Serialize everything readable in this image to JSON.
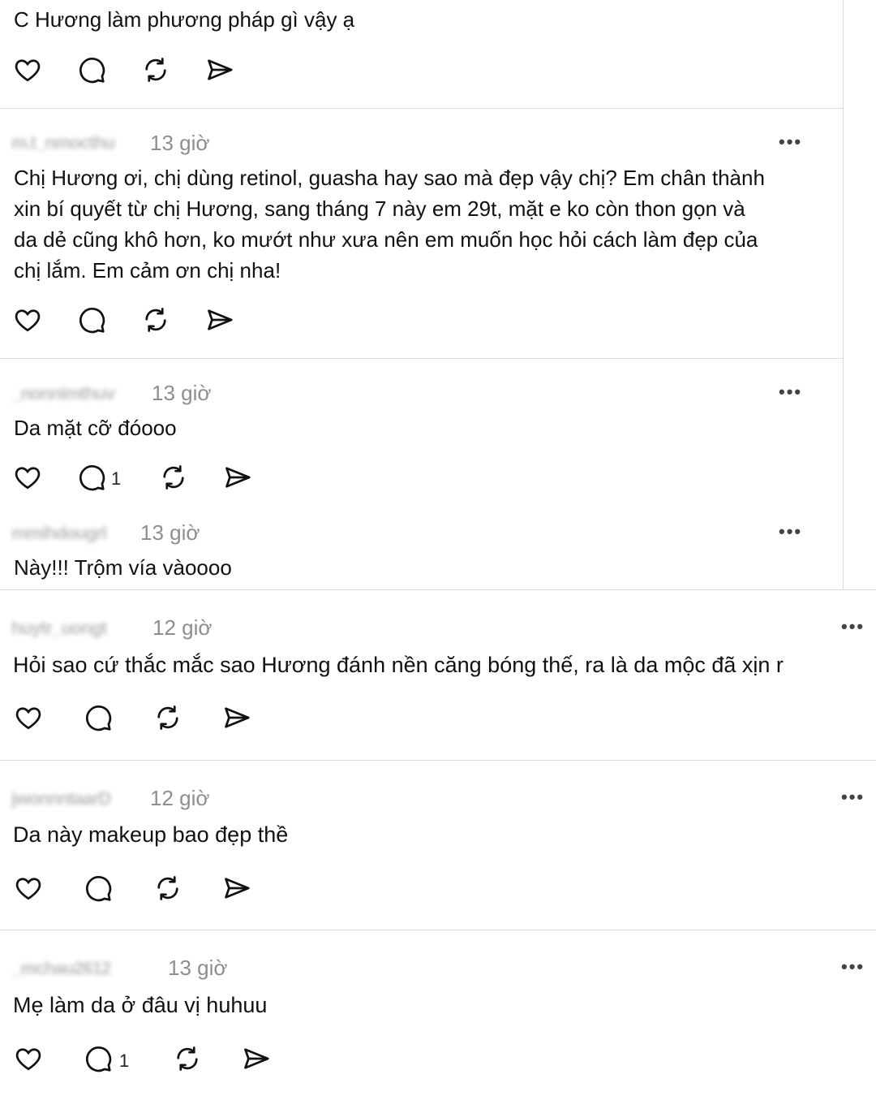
{
  "comments": [
    {
      "username": "",
      "time": "",
      "text": "C Hương làm phương pháp gì vậy ạ",
      "reply_count": ""
    },
    {
      "username": "m.t_nmocthu",
      "time": "13 giờ",
      "text": "Chị Hương ơi, chị dùng retinol, guasha hay sao mà đẹp vậy chị? Em chân thành\nxin bí quyết từ chị Hương, sang tháng 7 này em 29t, mặt e ko còn thon gọn và\nda dẻ cũng khô hơn, ko mướt như xưa nên em muốn học hỏi cách làm đẹp của\nchị lắm. Em cảm ơn chị nha!",
      "reply_count": ""
    },
    {
      "username": "_nonnimthuv",
      "time": "13 giờ",
      "text": "Da mặt cỡ đóooo",
      "reply_count": "1"
    },
    {
      "username": "mmihdougrl",
      "time": "13 giờ",
      "text": "Này!!! Trộm vía vàoooo",
      "reply_count": ""
    },
    {
      "username": "huytr_uongt",
      "time": "12 giờ",
      "text": "Hỏi sao cứ thắc mắc sao Hương đánh nền căng bóng thế, ra là da mộc đã xịn r",
      "reply_count": ""
    },
    {
      "username": "jwonnntaarD",
      "time": "12 giờ",
      "text": "Da này makeup bao đẹp thề",
      "reply_count": ""
    },
    {
      "username": "_mchau2612",
      "time": "13 giờ",
      "text": "Mẹ làm da ở đâu vị huhuu",
      "reply_count": "1"
    }
  ],
  "more_label": "•••",
  "icons": [
    "heart-icon",
    "comment-icon",
    "repost-icon",
    "share-icon"
  ]
}
